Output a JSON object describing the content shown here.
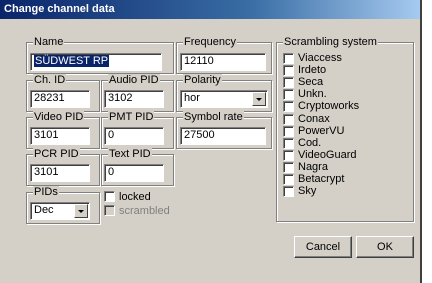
{
  "dialog": {
    "title": "Change channel data"
  },
  "name": {
    "label": "Name",
    "value": "SÜDWEST RP"
  },
  "frequency": {
    "label": "Frequency",
    "value": "12110"
  },
  "ch_id": {
    "label": "Ch. ID",
    "value": "28231"
  },
  "audio_pid": {
    "label": "Audio PID",
    "value": "3102"
  },
  "polarity": {
    "label": "Polarity",
    "value": "hor"
  },
  "video_pid": {
    "label": "Video PID",
    "value": "3101"
  },
  "pmt_pid": {
    "label": "PMT PID",
    "value": "0"
  },
  "symbol_rate": {
    "label": "Symbol rate",
    "value": "27500"
  },
  "pcr_pid": {
    "label": "PCR PID",
    "value": "3101"
  },
  "text_pid": {
    "label": "Text PID",
    "value": "0"
  },
  "pids": {
    "label": "PIDs",
    "value": "Dec"
  },
  "flags": {
    "locked": "locked",
    "scrambled": "scrambled"
  },
  "scrambling": {
    "label": "Scrambling system",
    "items": [
      "Viaccess",
      "Irdeto",
      "Seca",
      "Unkn.",
      "Cryptoworks",
      "Conax",
      "PowerVU",
      "Cod.",
      "VideoGuard",
      "Nagra",
      "Betacrypt",
      "Sky"
    ]
  },
  "buttons": {
    "cancel": "Cancel",
    "ok": "OK"
  }
}
